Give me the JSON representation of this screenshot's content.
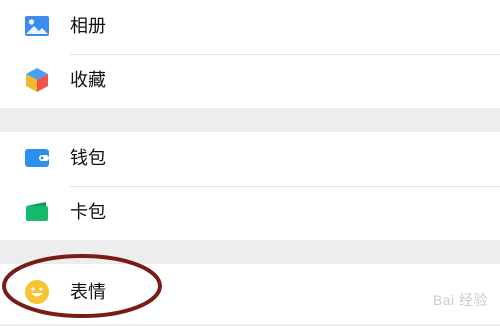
{
  "groups": [
    {
      "items": [
        {
          "label": "相册",
          "icon": "photo-album-icon"
        },
        {
          "label": "收藏",
          "icon": "favorites-cube-icon"
        }
      ]
    },
    {
      "items": [
        {
          "label": "钱包",
          "icon": "wallet-icon"
        },
        {
          "label": "卡包",
          "icon": "card-pack-icon"
        }
      ]
    },
    {
      "items": [
        {
          "label": "表情",
          "icon": "smiley-emoji-icon"
        }
      ]
    }
  ],
  "watermark": {
    "text": "Bai 经验"
  },
  "colors": {
    "background": "#ededed",
    "row_background": "#ffffff",
    "album_blue": "#3a8cef",
    "wallet_blue": "#2f8ff0",
    "card_green": "#16b96c",
    "smiley_yellow": "#f7c531",
    "annotation_red": "#7a1c16"
  }
}
